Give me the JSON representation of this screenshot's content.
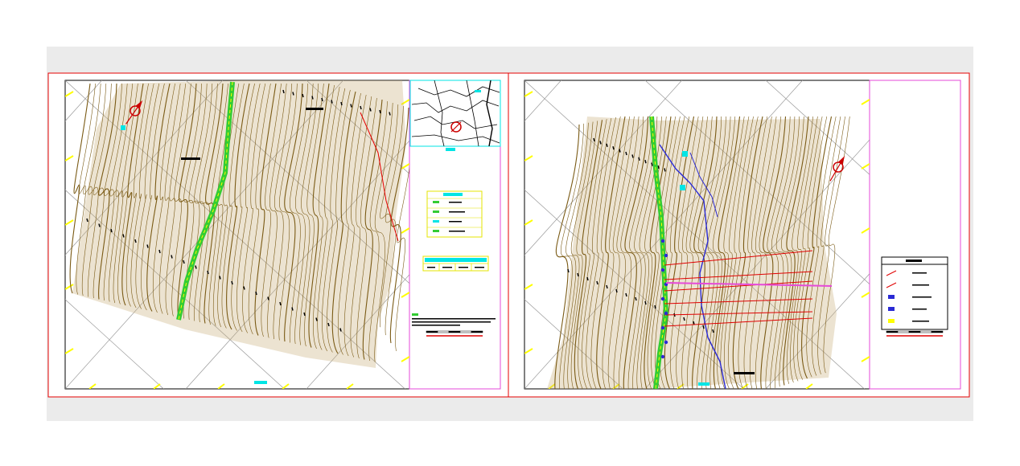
{
  "drawing": {
    "sheet_count": 2,
    "colors": {
      "background": "#ffffff",
      "model_space": "#ebebeb",
      "sheet_border": "#e60000",
      "title_block": "#e64ad9",
      "viewport_frame": "#000000",
      "contour": "#7a5a14",
      "road": "#33cc33",
      "road_axis": "#ffff00",
      "grid": "#9a9a9a",
      "marker_yellow": "#ffff00",
      "cyan_label": "#00e5e5",
      "river": "#2a2ad4",
      "section_lines": "#e00000",
      "north_arrow": "#cc0000"
    },
    "icons": [
      "north-arrow-icon",
      "location-map-icon",
      "legend-swatch-icon"
    ]
  },
  "sheet1": {
    "legend_rows": 4,
    "scale_bar_segments": 5
  },
  "sheet2": {
    "legend_rows": 5,
    "scale_bar_segments": 5
  }
}
